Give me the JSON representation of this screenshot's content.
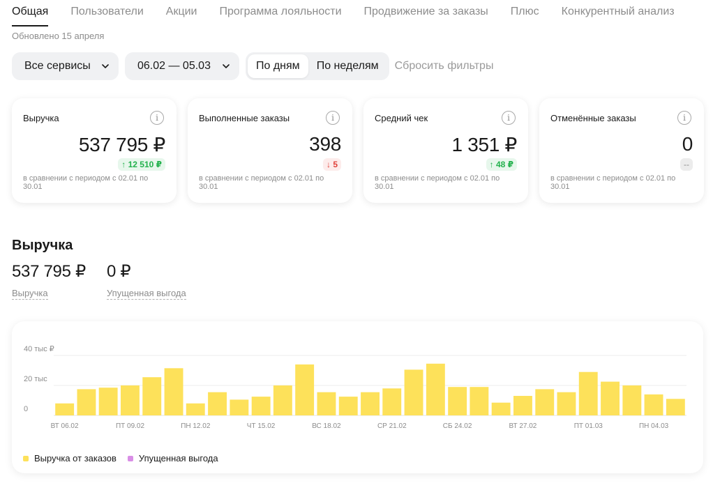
{
  "tabs": [
    {
      "label": "Общая",
      "active": true
    },
    {
      "label": "Пользователи"
    },
    {
      "label": "Акции"
    },
    {
      "label": "Программа лояльности"
    },
    {
      "label": "Продвижение за заказы"
    },
    {
      "label": "Плюс"
    },
    {
      "label": "Конкурентный анализ"
    }
  ],
  "updated": "Обновлено 15 апреля",
  "filters": {
    "service": "Все сервисы",
    "period": "06.02 — 05.03",
    "by_days": "По дням",
    "by_weeks": "По неделям",
    "reset": "Сбросить фильтры"
  },
  "cards": [
    {
      "title": "Выручка",
      "value": "537 795 ₽",
      "delta": "↑ 12 510 ₽",
      "delta_type": "up",
      "compare": "в сравнении с периодом с 02.01 по 30.01"
    },
    {
      "title": "Выполненные заказы",
      "value": "398",
      "delta": "↓ 5",
      "delta_type": "down",
      "compare": "в сравнении с периодом с 02.01 по 30.01"
    },
    {
      "title": "Средний чек",
      "value": "1 351 ₽",
      "delta": "↑ 48 ₽",
      "delta_type": "up",
      "compare": "в сравнении с периодом с 02.01 по 30.01"
    },
    {
      "title": "Отменённые заказы",
      "value": "0",
      "delta": "--",
      "delta_type": "na",
      "compare": "в сравнении с периодом с 02.01 по 30.01"
    }
  ],
  "revenue": {
    "title": "Выручка",
    "total_value": "537 795 ₽",
    "total_label": "Выручка",
    "lost_value": "0 ₽",
    "lost_label": "Упущенная выгода"
  },
  "chart_data": {
    "type": "bar",
    "y_ticks": [
      "40 тыс ₽",
      "20 тыс",
      "0"
    ],
    "ylim": [
      0,
      40000
    ],
    "x_tick_labels": [
      "ВТ 06.02",
      "ПТ 09.02",
      "ПН 12.02",
      "ЧТ 15.02",
      "ВС 18.02",
      "СР 21.02",
      "СБ 24.02",
      "ВТ 27.02",
      "ПТ 01.03",
      "ПН 04.03"
    ],
    "categories": [
      "06.02",
      "07.02",
      "08.02",
      "09.02",
      "10.02",
      "11.02",
      "12.02",
      "13.02",
      "14.02",
      "15.02",
      "16.02",
      "17.02",
      "18.02",
      "19.02",
      "20.02",
      "21.02",
      "22.02",
      "23.02",
      "24.02",
      "25.02",
      "26.02",
      "27.02",
      "28.02",
      "29.02",
      "01.03",
      "02.03",
      "03.03",
      "04.03",
      "05.03"
    ],
    "series": [
      {
        "name": "Выручка от заказов",
        "color": "#fde15a",
        "values": [
          8000,
          17500,
          18500,
          20000,
          25500,
          31500,
          8000,
          15500,
          10500,
          12500,
          20000,
          34000,
          15500,
          12500,
          15500,
          18000,
          30500,
          34500,
          19000,
          19000,
          8500,
          13000,
          17500,
          15500,
          29000,
          22500,
          20000,
          14000,
          11000
        ]
      },
      {
        "name": "Упущенная выгода",
        "color": "#d98ee6",
        "values": [
          0,
          0,
          0,
          0,
          0,
          0,
          0,
          0,
          0,
          0,
          0,
          0,
          0,
          0,
          0,
          0,
          0,
          0,
          0,
          0,
          0,
          0,
          0,
          0,
          0,
          0,
          0,
          0,
          0
        ]
      }
    ]
  }
}
